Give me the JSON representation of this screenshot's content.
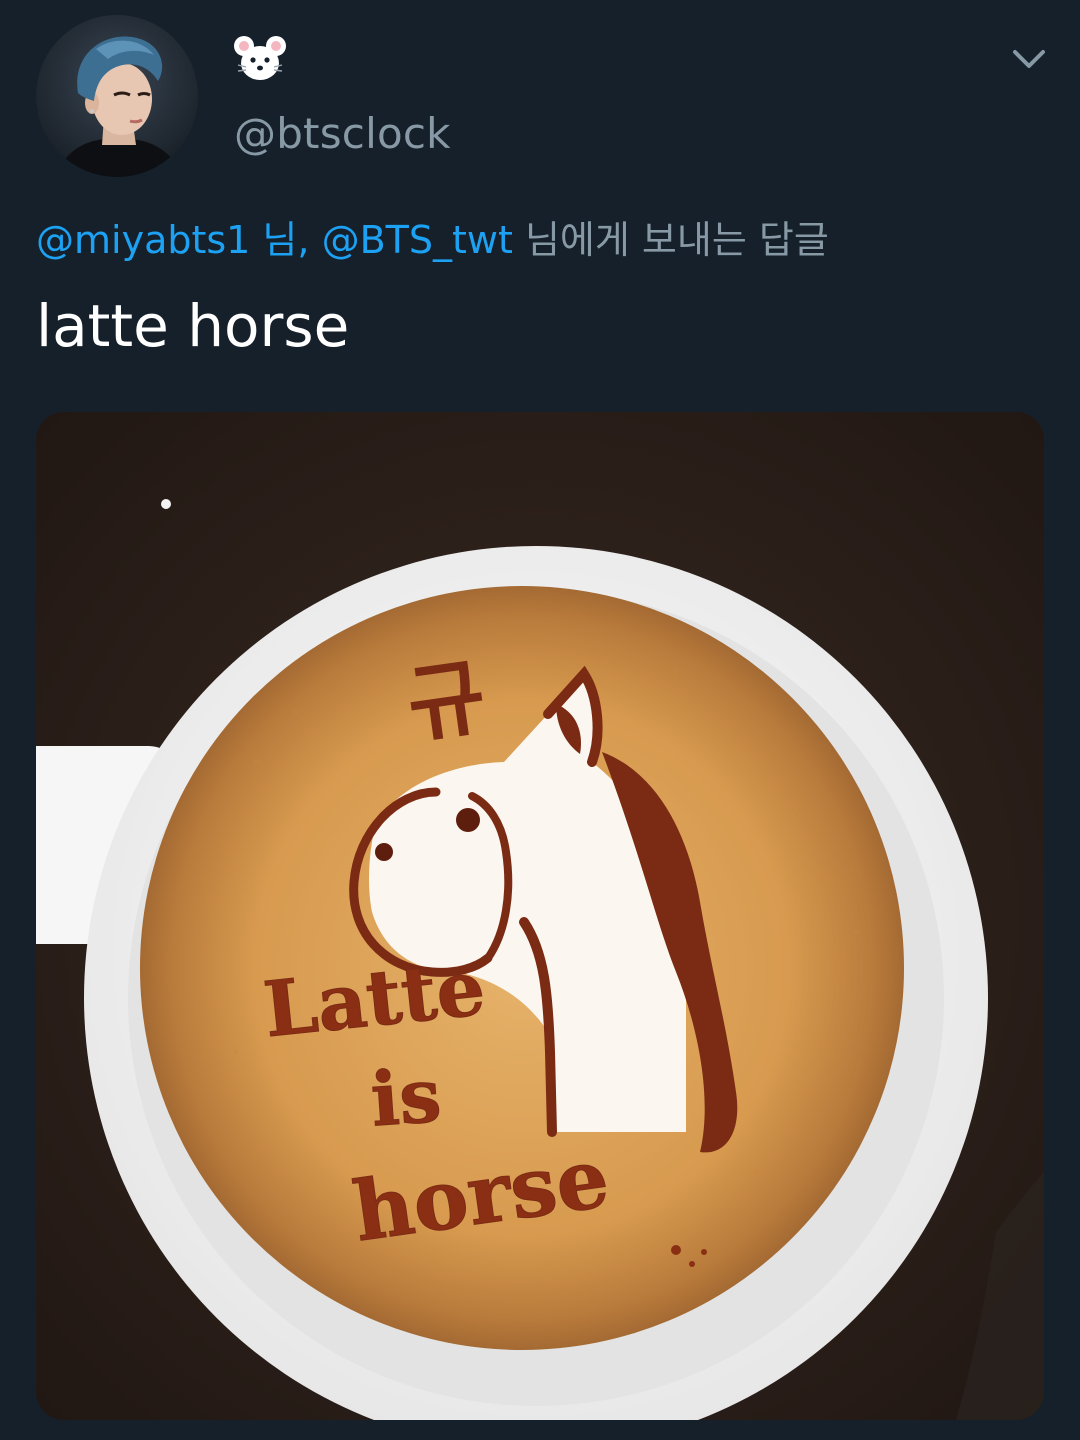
{
  "tweet": {
    "display_name_icon": "mouse-face-emoji-icon",
    "handle": "@btsclock",
    "menu_icon": "chevron-down-icon",
    "reply_context": {
      "mention_1": "@miyabts1 님,",
      "mention_2": "@BTS_twt",
      "suffix": "님에게 보내는 답글"
    },
    "text": "latte horse",
    "media": {
      "art_text_line_1": "Latte",
      "art_text_line_2": "is",
      "art_text_line_3": "horse",
      "art_symbol": "규"
    }
  },
  "colors": {
    "background": "#15202b",
    "mention": "#1da1f2",
    "secondary_text": "#8899a6",
    "primary_text": "#ffffff"
  }
}
